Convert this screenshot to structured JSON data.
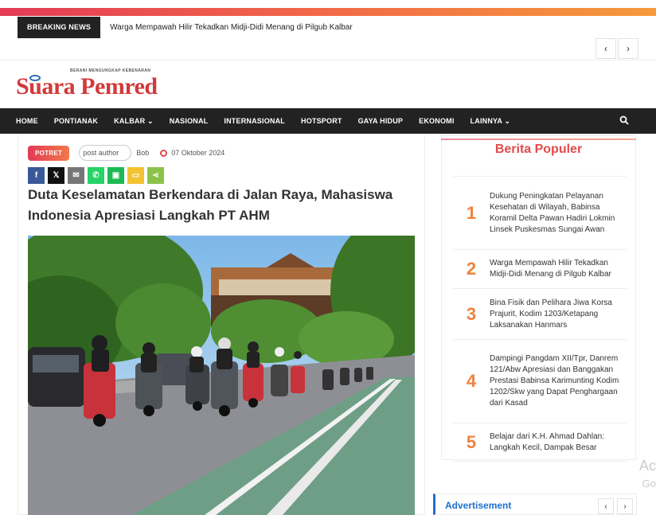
{
  "breaking": {
    "label": "BREAKING NEWS",
    "headline": "Warga Mempawah Hilir Tekadkan Midji-Didi Menang di Pilgub Kalbar"
  },
  "logo": {
    "tagline": "BERANI MENGUNGKAP KEBENARAN",
    "name": "Suara Pemred"
  },
  "menu": [
    "HOME",
    "PONTIANAK",
    "KALBAR",
    "NASIONAL",
    "INTERNASIONAL",
    "HOTSPORT",
    "GAYA HIDUP",
    "EKONOMI",
    "LAINNYA"
  ],
  "article": {
    "category": "POTRET",
    "author_img_alt": "post author",
    "author": "Bob",
    "date": "07 Oktober 2024",
    "title": "Duta Keselamatan Berkendara di Jalan Raya, Mahasiswa Indonesia Apresiasi Langkah PT AHM"
  },
  "sidebar": {
    "title": "Berita Populer",
    "items": [
      {
        "num": "1",
        "text": "Dukung Peningkatan Pelayanan Kesehatan di Wilayah, Babinsa Koramil Delta Pawan Hadiri Lokmin Linsek Puskesmas Sungai Awan"
      },
      {
        "num": "2",
        "text": "Warga Mempawah Hilir Tekadkan Midji-Didi Menang di Pilgub Kalbar"
      },
      {
        "num": "3",
        "text": "Bina Fisik dan Pelihara Jiwa Korsa Prajurit, Kodim 1203/Ketapang Laksanakan Hanmars"
      },
      {
        "num": "4",
        "text": "Dampingi Pangdam XII/Tpr, Danrem 121/Abw Apresiasi dan Banggakan Prestasi Babinsa Karimunting Kodim 1202/Skw yang Dapat Penghargaan dari Kasad"
      },
      {
        "num": "5",
        "text": "Belajar dari K.H. Ahmad Dahlan: Langkah Kecil, Dampak Besar"
      }
    ]
  },
  "advertisement": {
    "label": "Advertisement"
  },
  "overlay": {
    "line1": "Ac",
    "line2": "Go"
  },
  "colors": {
    "accent": "#e24b4b",
    "number": "#f0823b",
    "ad_blue": "#1f6fd0",
    "menu_bg": "#222222"
  }
}
